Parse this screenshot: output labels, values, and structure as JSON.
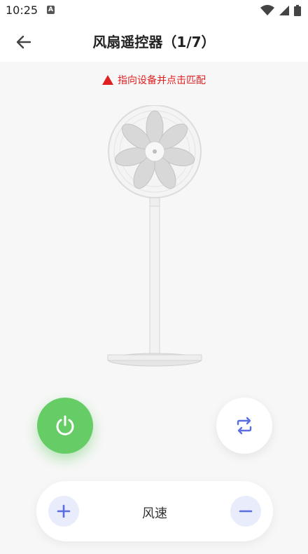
{
  "status_bar": {
    "time": "10:25",
    "notification_badge": "A"
  },
  "header": {
    "title": "风扇遥控器（1/7）"
  },
  "hint": {
    "text": "指向设备并点击匹配"
  },
  "controls": {
    "speed_label": "风速"
  },
  "colors": {
    "accent_green": "#66cc66",
    "accent_blue": "#5b6ee1",
    "warning_red": "#e02020"
  },
  "icons": [
    "wifi-icon",
    "signal-icon",
    "battery-icon",
    "back-arrow-icon",
    "warning-triangle-icon",
    "power-icon",
    "swing-icon",
    "plus-icon",
    "minus-icon"
  ]
}
